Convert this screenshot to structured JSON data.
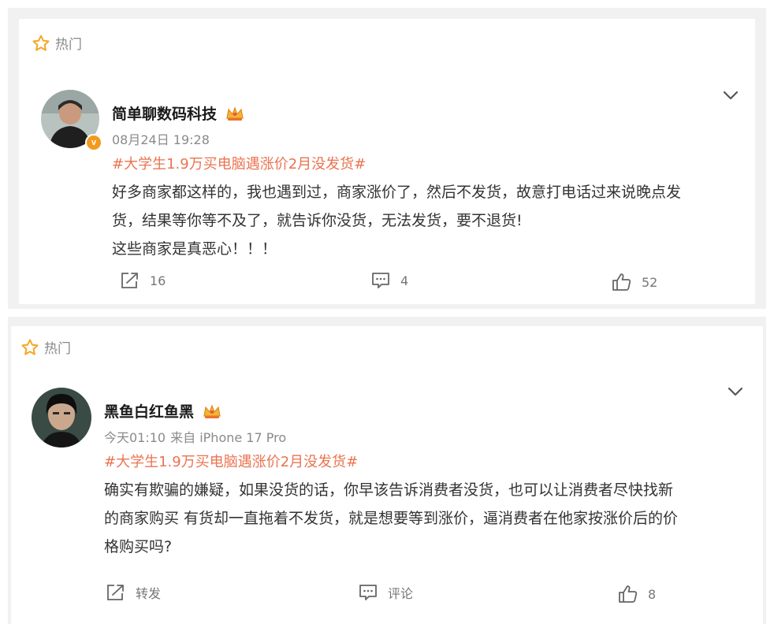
{
  "posts": [
    {
      "hot_label": "热门",
      "author": "简单聊数码科技",
      "verified_mark": "v",
      "time": "08月24日 19:28",
      "source": "",
      "topic": "#大学生1.9万买电脑遇涨价2月没发货#",
      "content_lines": [
        "好多商家都这样的，我也遇到过，商家涨价了，然后不发货，故意打电话过来说晚点发",
        "货，结果等你等不及了，就告诉你没货，无法发货，要不退货!",
        "这些商家是真恶心！！！"
      ],
      "repost": "16",
      "comment": "4",
      "like": "52"
    },
    {
      "hot_label": "热门",
      "author": "黑鱼白红鱼黑",
      "verified_mark": "",
      "time": "今天01:10",
      "source": "来自 iPhone 17 Pro",
      "topic": "#大学生1.9万买电脑遇涨价2月没发货#",
      "content_lines": [
        "确实有欺骗的嫌疑，如果没货的话，你早该告诉消费者没货，也可以让消费者尽快找新",
        "的商家购买 有货却一直拖着不发货，就是想要等到涨价，逼消费者在他家按涨价后的价",
        "格购买吗?"
      ],
      "repost": "转发",
      "comment": "评论",
      "like": "8"
    }
  ],
  "colors": {
    "topic": "#eb7350",
    "badge": "#f29a1d",
    "star": "#f5a623",
    "muted": "#8a8a8a"
  },
  "icons": {
    "hot": "star-icon",
    "menu": "chevron-down-icon",
    "repost": "share-icon",
    "comment": "comment-icon",
    "like": "thumbs-up-icon",
    "rank": "crown-icon"
  }
}
